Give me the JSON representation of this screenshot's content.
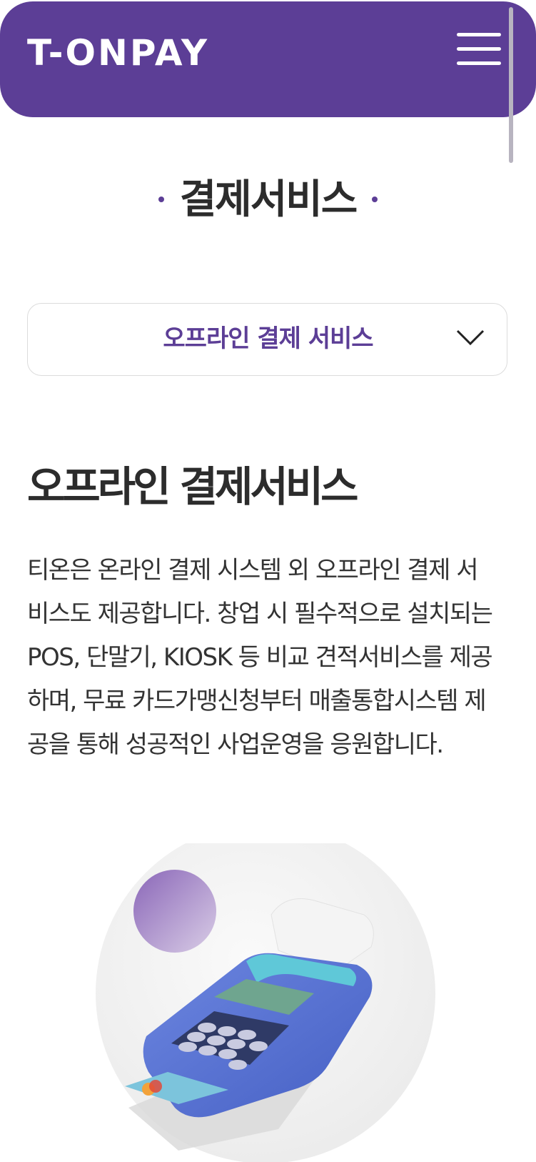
{
  "header": {
    "logo": "T-ONPAY",
    "background": "#5c3e96",
    "menu_icon": "hamburger-menu-icon"
  },
  "page": {
    "title": "결제서비스"
  },
  "select": {
    "value": "오프라인 결제 서비스",
    "icon": "chevron-down-icon",
    "accent": "#5c3e96"
  },
  "section": {
    "title": "오프라인 결제서비스",
    "lines": [
      "티온은 온라인 결제 시스템 외 오프라인 결제 서",
      "비스도 제공합니다. 창업 시 필수적으로 설치되는",
      "POS, 단말기, KIOSK 등 비교 견적서비스를 제공",
      "하며, 무료 카드가맹신청부터 매출통합시스템 제",
      "공을 통해 성공적인 사업운영을 응원합니다."
    ]
  },
  "illustration": {
    "icon": "card-payment-terminal-icon"
  }
}
